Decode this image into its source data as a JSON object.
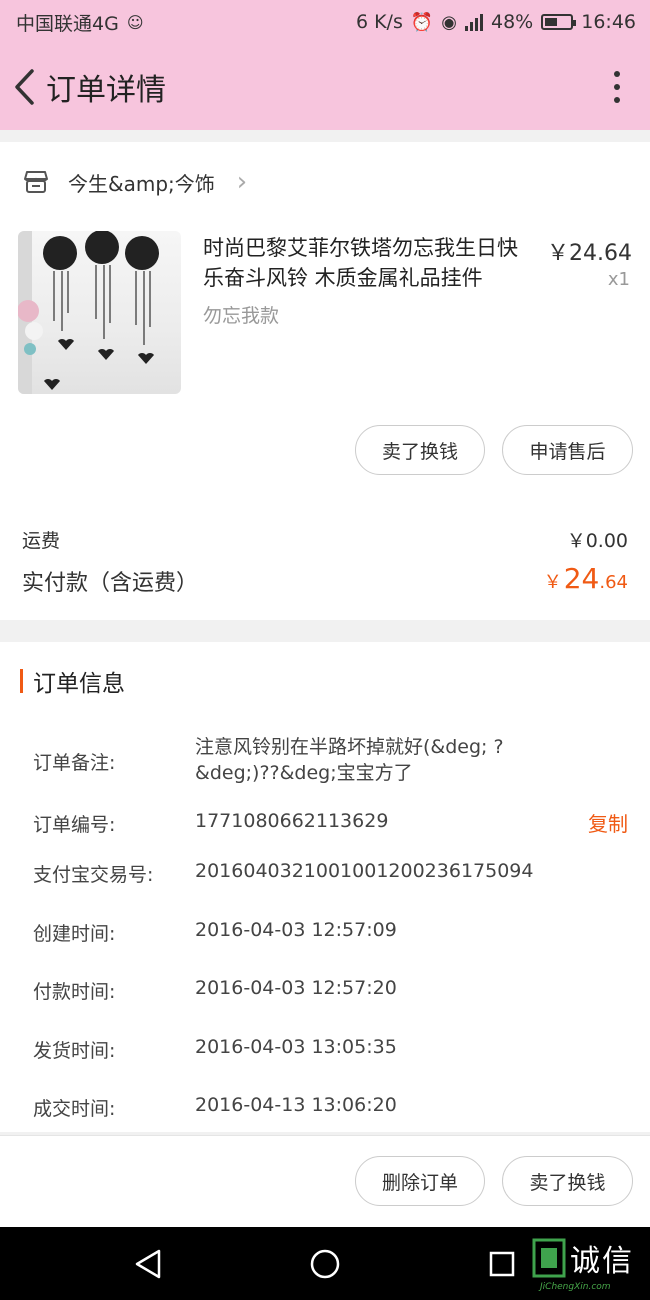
{
  "status_bar": {
    "carrier": "中国联通4G",
    "speed": "6 K/s",
    "battery": "48%",
    "time": "16:46"
  },
  "header": {
    "title": "订单详情"
  },
  "shop": {
    "name": "今生&amp;今饰"
  },
  "product": {
    "title": "时尚巴黎艾菲尔铁塔勿忘我生日快乐奋斗风铃 木质金属礼品挂件",
    "variant": "勿忘我款",
    "price": "￥24.64",
    "quantity": "x1"
  },
  "item_actions": {
    "sell_label": "卖了换钱",
    "after_sale_label": "申请售后"
  },
  "payment": {
    "shipping_label": "运费",
    "shipping_value": "￥0.00",
    "paid_label": "实付款（含运费）",
    "paid_currency": "￥",
    "paid_integer": "24",
    "paid_decimal": ".64"
  },
  "order_info": {
    "title": "订单信息",
    "rows": [
      {
        "label": "订单备注:",
        "value": "注意风铃别在半路坏掉就好(&deg; ? &deg;)??&deg;宝宝方了"
      },
      {
        "label": "订单编号:",
        "value": "1771080662113629"
      },
      {
        "label": "支付宝交易号:",
        "value": "2016040321001001200236175094"
      },
      {
        "label": "创建时间:",
        "value": "2016-04-03 12:57:09"
      },
      {
        "label": "付款时间:",
        "value": "2016-04-03 12:57:20"
      },
      {
        "label": "发货时间:",
        "value": "2016-04-03 13:05:35"
      },
      {
        "label": "成交时间:",
        "value": "2016-04-13 13:06:20"
      }
    ],
    "copy_label": "复制"
  },
  "bottom_actions": {
    "delete_label": "删除订单",
    "sell_label": "卖了换钱"
  },
  "watermark": {
    "text": "诚信",
    "sub": "JiChengXin.com"
  },
  "colors": {
    "header_bg": "#f7c5dd",
    "accent": "#f05a14"
  }
}
